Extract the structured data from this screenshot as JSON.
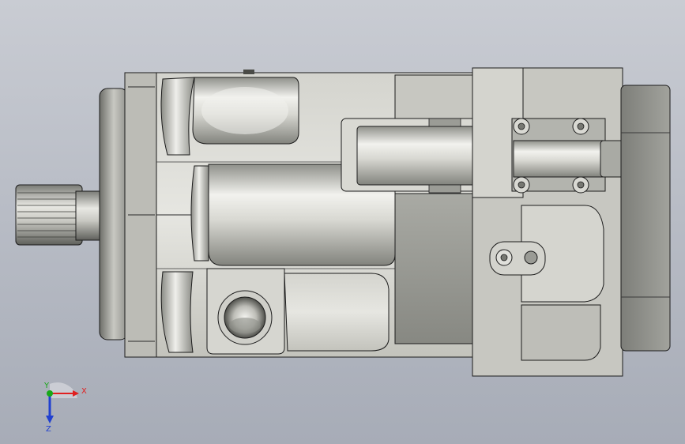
{
  "viewport": {
    "model": "hydraulic-motor-assembly",
    "view": "top"
  },
  "triad": {
    "x_label": "X",
    "y_label": "Y",
    "z_label": "Z",
    "x_color": "#e02020",
    "y_color": "#18a818",
    "z_color": "#2040d0"
  },
  "colors": {
    "background_top": "#c9ccd3",
    "background_bottom": "#a7acb7",
    "metal_light": "#e9e9e4",
    "metal_mid": "#b7b7b0",
    "metal_dark": "#6f706b",
    "edge": "#1c1c1c"
  }
}
